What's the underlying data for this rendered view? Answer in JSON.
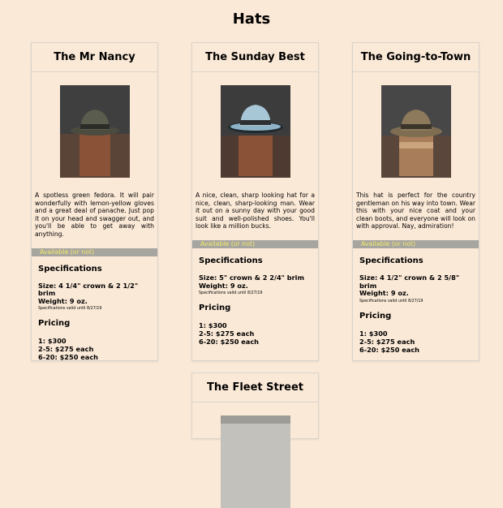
{
  "page": {
    "title": "Hats"
  },
  "cards": [
    {
      "name": "The Mr Nancy",
      "image": "hat-green-fedora",
      "description": "A spotless green fedora. It will pair wonderfully with lemon-yellow gloves and a great deal of panache. Just pop it on your head and swagger out, and you'll be able to get away with anything.",
      "availability": "Available (or not)",
      "specs_heading": "Specifications",
      "size": "Size: 4 1/4\" crown & 2 1/2\" brim",
      "weight": "Weight: 9 oz.",
      "specs_note": "Specifications valid until 8/27/19",
      "pricing_heading": "Pricing",
      "prices": [
        "1: $300",
        "2-5: $275 each",
        "6-20: $250 each"
      ]
    },
    {
      "name": "The Sunday Best",
      "image": "hat-blue-fedora",
      "description": "A nice, clean, sharp looking hat for a nice, clean, sharp-looking man. Wear it out on a sunny day with your good suit and well-polished shoes. You'll look like a million bucks.",
      "availability": "Available (or not)",
      "specs_heading": "Specifications",
      "size": "Size: 5\" crown & 2 2/4\" brim",
      "weight": "Weight: 9 oz.",
      "specs_note": "Specifications valid until 8/27/19",
      "pricing_heading": "Pricing",
      "prices": [
        "1: $300",
        "2-5: $275 each",
        "6-20: $250 each"
      ]
    },
    {
      "name": "The Going-to-Town",
      "image": "hat-tan-fedora",
      "description": "This hat is perfect for the country gentleman on his way into town. Wear this with your nice coat and your clean boots, and everyone will look on with approval. Nay, admiration!",
      "availability": "Available (or not)",
      "specs_heading": "Specifications",
      "size": "Size: 4 1/2\" crown & 2 5/8\" brim",
      "weight": "Weight: 9 oz.",
      "specs_note": "Specifications valid until 8/27/19",
      "pricing_heading": "Pricing",
      "prices": [
        "1: $300",
        "2-5: $275 each",
        "6-20: $250 each"
      ]
    },
    {
      "name": "The Fleet Street",
      "image": "hat-grey-fedora"
    }
  ],
  "colors": {
    "background": "#fbe9d7",
    "availability_bar": "#a7a59f",
    "availability_text": "#f4ea6c",
    "card_border": "#d8d4cc"
  }
}
